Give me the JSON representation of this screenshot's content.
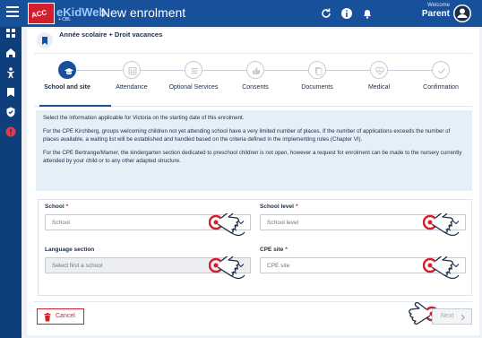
{
  "topbar": {
    "title": "New enrolment",
    "logo_brand": "eKidWeb",
    "logo_badge": "ACC",
    "logo_sub": "+ CBL",
    "welcome": "Welcome",
    "user": "Parent",
    "bg_color": "#17509b"
  },
  "sidebar": {
    "items": [
      "dashboard-icon",
      "home-icon",
      "child-icon",
      "book-icon",
      "shield-icon",
      "alert-icon"
    ]
  },
  "header": {
    "title": "Année scolaire + Droit vacances"
  },
  "steps": [
    {
      "label": "School and site",
      "icon": "graduation-cap-icon",
      "active": true
    },
    {
      "label": "Attendance",
      "icon": "calendar-icon",
      "active": false
    },
    {
      "label": "Optional Services",
      "icon": "list-icon",
      "active": false
    },
    {
      "label": "Consents",
      "icon": "thumbs-up-icon",
      "active": false
    },
    {
      "label": "Documents",
      "icon": "documents-icon",
      "active": false
    },
    {
      "label": "Medical",
      "icon": "heart-pulse-icon",
      "active": false
    },
    {
      "label": "Confirmation",
      "icon": "check-icon",
      "active": false
    }
  ],
  "info": {
    "p1": "Select the information applicable for Victoria on the starting date of this enrolment.",
    "p2": "For the CPE Kirchberg, groups welcoming children not yet attending school have a very limited number of places. If the number of applications exceeds the number of places available, a waiting list will be established and handled based on the criteria defined in the implementing rules (Chapter VI).",
    "p3": "For the CPE Bertrange/Mamer, the kindergarten section dedicated to preschool children is not open, however a request for enrolment can be made to the nursery currently attended by your child or to any other adapted structure."
  },
  "form": {
    "school_label": "School",
    "school_placeholder": "School",
    "school_level_label": "School level",
    "school_level_placeholder": "School level",
    "language_label": "Language section",
    "language_placeholder": "Select first a school",
    "cpe_label": "CPE site",
    "cpe_placeholder": "CPE site",
    "required_mark": "*"
  },
  "footer": {
    "cancel": "Cancel",
    "next": "Next"
  },
  "colors": {
    "primary": "#17509b",
    "danger": "#d21f2e",
    "info_bg": "#e4eff8"
  }
}
